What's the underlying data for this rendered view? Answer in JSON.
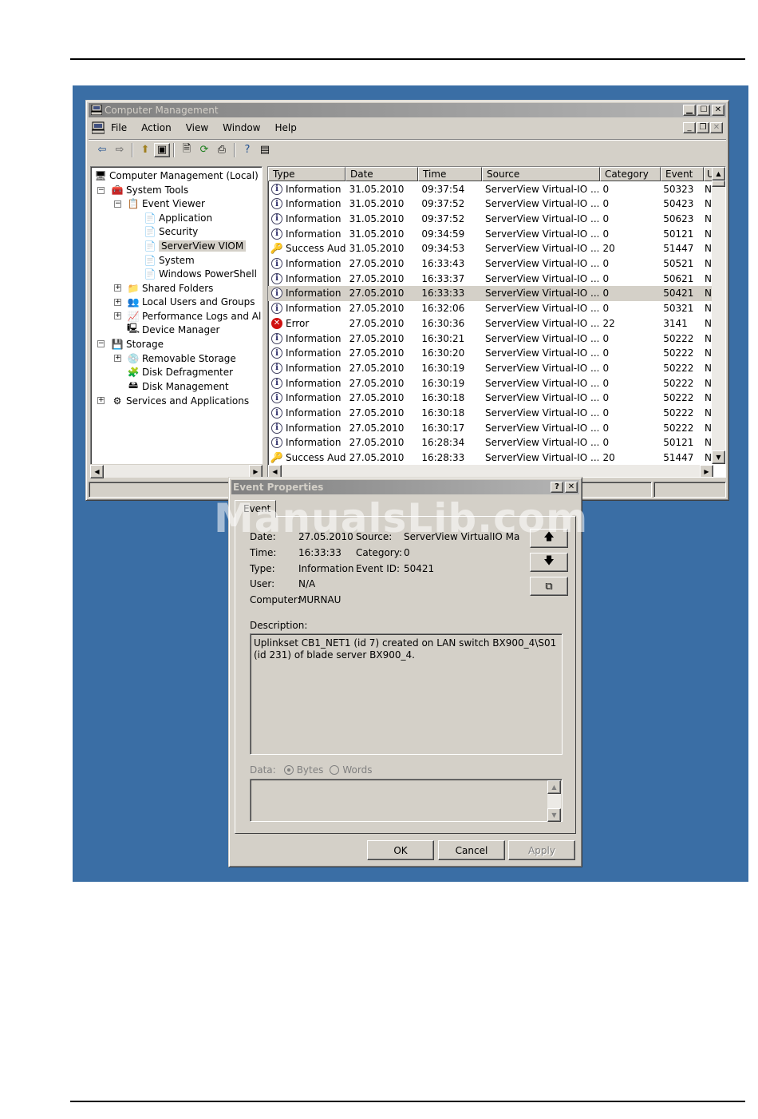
{
  "main_window": {
    "title": "Computer Management",
    "menu": [
      "File",
      "Action",
      "View",
      "Window",
      "Help"
    ],
    "tree": [
      {
        "label": "Computer Management (Local)"
      },
      {
        "label": "System Tools"
      },
      {
        "label": "Event Viewer"
      },
      {
        "label": "Application"
      },
      {
        "label": "Security"
      },
      {
        "label": "ServerView VIOM",
        "selected": true
      },
      {
        "label": "System"
      },
      {
        "label": "Windows PowerShell"
      },
      {
        "label": "Shared Folders"
      },
      {
        "label": "Local Users and Groups"
      },
      {
        "label": "Performance Logs and Alerts"
      },
      {
        "label": "Device Manager"
      },
      {
        "label": "Storage"
      },
      {
        "label": "Removable Storage"
      },
      {
        "label": "Disk Defragmenter"
      },
      {
        "label": "Disk Management"
      },
      {
        "label": "Services and Applications"
      }
    ],
    "columns": [
      "Type",
      "Date",
      "Time",
      "Source",
      "Category",
      "Event",
      "U"
    ],
    "rows": [
      {
        "icon": "info",
        "type": "Information",
        "date": "31.05.2010",
        "time": "09:37:54",
        "source": "ServerView Virtual-IO ...",
        "category": "0",
        "event": "50323",
        "user": "N"
      },
      {
        "icon": "info",
        "type": "Information",
        "date": "31.05.2010",
        "time": "09:37:52",
        "source": "ServerView Virtual-IO ...",
        "category": "0",
        "event": "50423",
        "user": "N"
      },
      {
        "icon": "info",
        "type": "Information",
        "date": "31.05.2010",
        "time": "09:37:52",
        "source": "ServerView Virtual-IO ...",
        "category": "0",
        "event": "50623",
        "user": "N"
      },
      {
        "icon": "info",
        "type": "Information",
        "date": "31.05.2010",
        "time": "09:34:59",
        "source": "ServerView Virtual-IO ...",
        "category": "0",
        "event": "50121",
        "user": "N"
      },
      {
        "icon": "audit",
        "type": "Success Audit",
        "date": "31.05.2010",
        "time": "09:34:53",
        "source": "ServerView Virtual-IO ...",
        "category": "20",
        "event": "51447",
        "user": "N"
      },
      {
        "icon": "info",
        "type": "Information",
        "date": "27.05.2010",
        "time": "16:33:43",
        "source": "ServerView Virtual-IO ...",
        "category": "0",
        "event": "50521",
        "user": "N"
      },
      {
        "icon": "info",
        "type": "Information",
        "date": "27.05.2010",
        "time": "16:33:37",
        "source": "ServerView Virtual-IO ...",
        "category": "0",
        "event": "50621",
        "user": "N"
      },
      {
        "icon": "info",
        "type": "Information",
        "date": "27.05.2010",
        "time": "16:33:33",
        "source": "ServerView Virtual-IO ...",
        "category": "0",
        "event": "50421",
        "user": "N",
        "highlighted": true
      },
      {
        "icon": "info",
        "type": "Information",
        "date": "27.05.2010",
        "time": "16:32:06",
        "source": "ServerView Virtual-IO ...",
        "category": "0",
        "event": "50321",
        "user": "N"
      },
      {
        "icon": "error",
        "type": "Error",
        "date": "27.05.2010",
        "time": "16:30:36",
        "source": "ServerView Virtual-IO ...",
        "category": "22",
        "event": "3141",
        "user": "N"
      },
      {
        "icon": "info",
        "type": "Information",
        "date": "27.05.2010",
        "time": "16:30:21",
        "source": "ServerView Virtual-IO ...",
        "category": "0",
        "event": "50222",
        "user": "N"
      },
      {
        "icon": "info",
        "type": "Information",
        "date": "27.05.2010",
        "time": "16:30:20",
        "source": "ServerView Virtual-IO ...",
        "category": "0",
        "event": "50222",
        "user": "N"
      },
      {
        "icon": "info",
        "type": "Information",
        "date": "27.05.2010",
        "time": "16:30:19",
        "source": "ServerView Virtual-IO ...",
        "category": "0",
        "event": "50222",
        "user": "N"
      },
      {
        "icon": "info",
        "type": "Information",
        "date": "27.05.2010",
        "time": "16:30:19",
        "source": "ServerView Virtual-IO ...",
        "category": "0",
        "event": "50222",
        "user": "N"
      },
      {
        "icon": "info",
        "type": "Information",
        "date": "27.05.2010",
        "time": "16:30:18",
        "source": "ServerView Virtual-IO ...",
        "category": "0",
        "event": "50222",
        "user": "N"
      },
      {
        "icon": "info",
        "type": "Information",
        "date": "27.05.2010",
        "time": "16:30:18",
        "source": "ServerView Virtual-IO ...",
        "category": "0",
        "event": "50222",
        "user": "N"
      },
      {
        "icon": "info",
        "type": "Information",
        "date": "27.05.2010",
        "time": "16:30:17",
        "source": "ServerView Virtual-IO ...",
        "category": "0",
        "event": "50222",
        "user": "N"
      },
      {
        "icon": "info",
        "type": "Information",
        "date": "27.05.2010",
        "time": "16:28:34",
        "source": "ServerView Virtual-IO ...",
        "category": "0",
        "event": "50121",
        "user": "N"
      },
      {
        "icon": "audit",
        "type": "Success Audit",
        "date": "27.05.2010",
        "time": "16:28:33",
        "source": "ServerView Virtual-IO ...",
        "category": "20",
        "event": "51447",
        "user": "N"
      }
    ]
  },
  "dialog": {
    "title": "Event Properties",
    "tab": "Event",
    "labels": {
      "date": "Date:",
      "time": "Time:",
      "type": "Type:",
      "user": "User:",
      "computer": "Computer:",
      "source": "Source:",
      "category": "Category:",
      "event_id": "Event ID:",
      "description": "Description:",
      "data": "Data:",
      "bytes": "Bytes",
      "words": "Words"
    },
    "values": {
      "date": "27.05.2010",
      "time": "16:33:33",
      "type": "Information",
      "user": "N/A",
      "computer": "MURNAU",
      "source": "ServerView VirtualIO Ma",
      "category": "0",
      "event_id": "50421"
    },
    "description": "Uplinkset CB1_NET1 (id 7) created on LAN switch BX900_4\\S01 (id 231) of blade server BX900_4.",
    "buttons": {
      "ok": "OK",
      "cancel": "Cancel",
      "apply": "Apply"
    }
  },
  "watermark": "ManualsLib.com",
  "colors": {
    "desktop": "#3a6ea5",
    "window_face": "#d4d0c8",
    "inactive_title": "#808080"
  }
}
